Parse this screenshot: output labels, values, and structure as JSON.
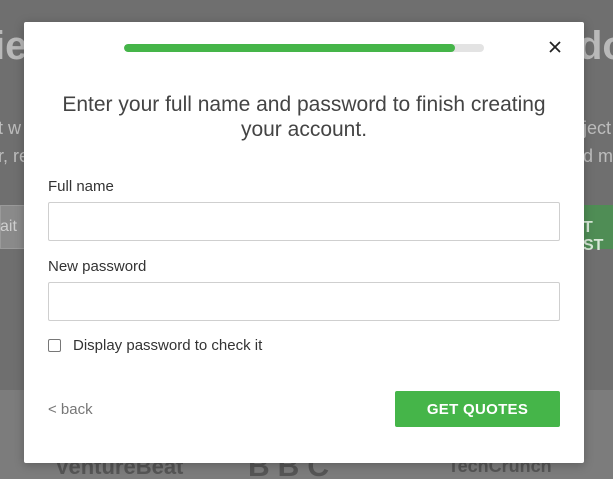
{
  "background": {
    "hero_fragments": [
      "ie",
      "do",
      "t w",
      "ject",
      "r, re",
      "d mo"
    ],
    "input_placeholder": "ait",
    "cta_label": "T ST",
    "logos": [
      "VentureBeat",
      "BBC",
      "TechCrunch"
    ]
  },
  "modal": {
    "progress_percent": 92,
    "title": "Enter your full name and password to finish creating your account.",
    "full_name_label": "Full name",
    "full_name_value": "",
    "password_label": "New password",
    "password_value": "",
    "show_password_label": "Display password to check it",
    "show_password_checked": false,
    "back_label": "< back",
    "submit_label": "GET QUOTES"
  },
  "colors": {
    "accent": "#45b549",
    "overlay": "#7a7a7a"
  }
}
